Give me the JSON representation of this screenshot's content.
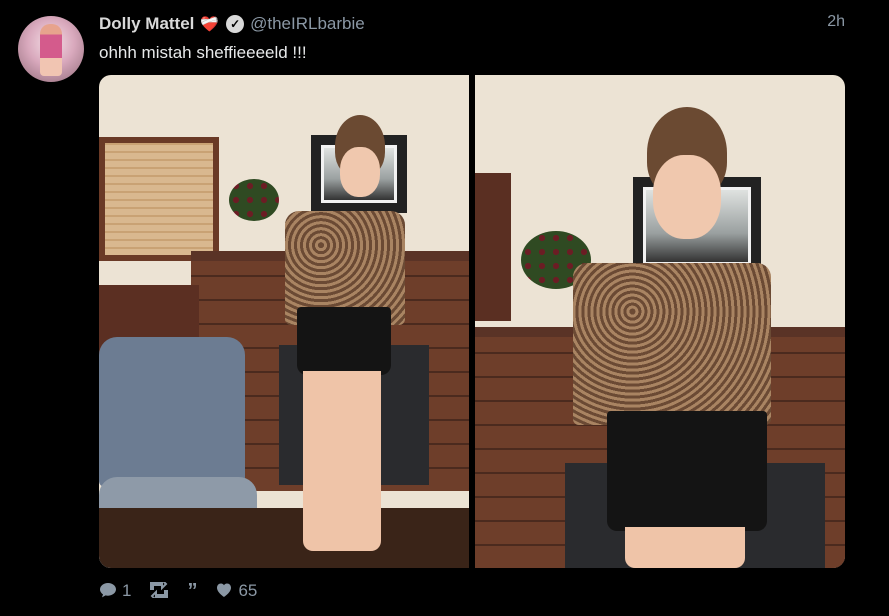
{
  "tweet": {
    "display_name": "Dolly Mattel",
    "name_emoji": "❤️‍🩹",
    "handle": "@theIRLbarbie",
    "timestamp": "2h",
    "text": "ohhh mistah sheffieeeeld !!!",
    "verified": true
  },
  "media": {
    "photo_count": 2
  },
  "actions": {
    "reply_count": "1",
    "like_count": "65"
  },
  "icons": {
    "reply": "speech-bubble-icon",
    "retweet": "retweet-icon",
    "quote": "quote-icon",
    "like": "heart-icon",
    "verified": "verified-check-icon"
  },
  "colors": {
    "background": "#000000",
    "text_primary": "#e7e9ea",
    "text_secondary": "#8b98a5"
  }
}
